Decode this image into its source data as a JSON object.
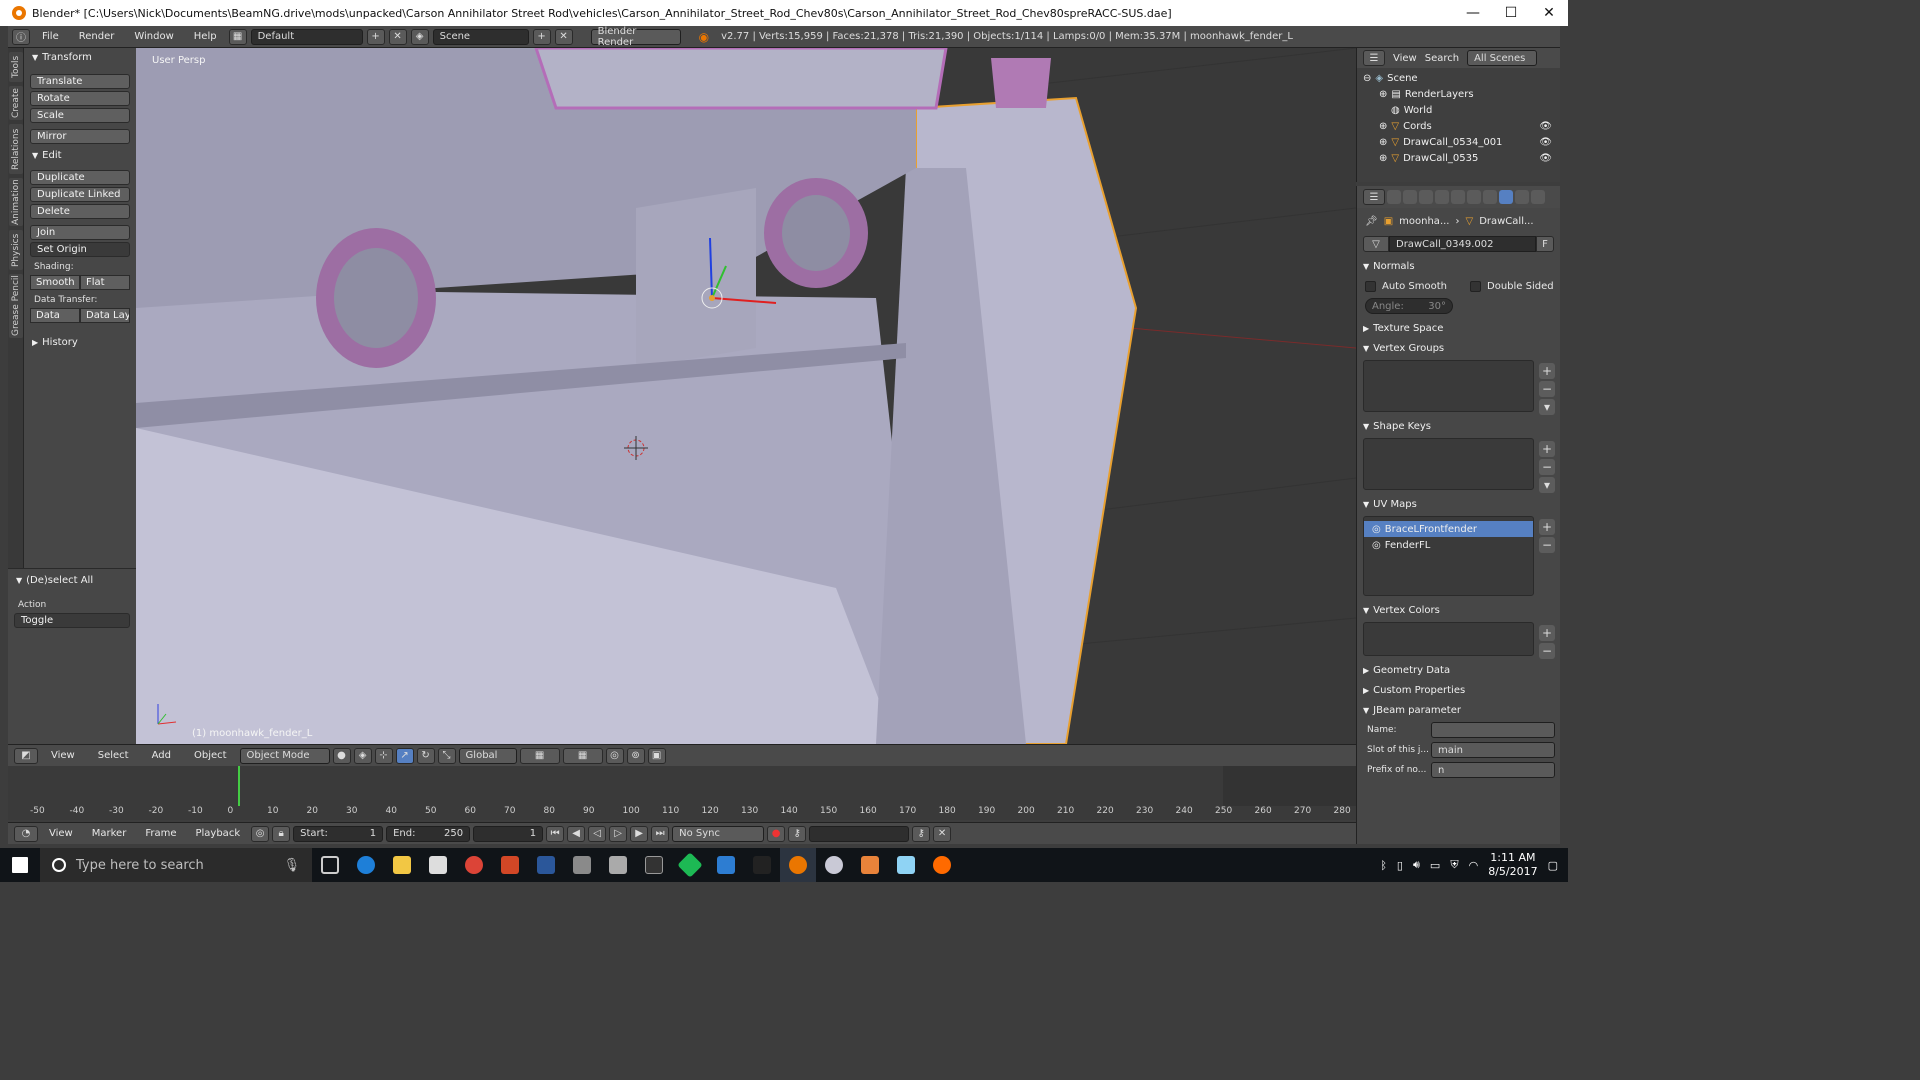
{
  "window": {
    "title": "Blender* [C:\\Users\\Nick\\Documents\\BeamNG.drive\\mods\\unpacked\\Carson Annihilator Street Rod\\vehicles\\Carson_Annihilator_Street_Rod_Chev80s\\Carson_Annihilator_Street_Rod_Chev80spreRACC-SUS.dae]",
    "minimize": "—",
    "maximize": "☐",
    "close": "✕"
  },
  "topbar": {
    "menus": [
      "File",
      "Render",
      "Window",
      "Help"
    ],
    "layout": "Default",
    "scene": "Scene",
    "engine": "Blender Render",
    "stats": "v2.77 | Verts:15,959 | Faces:21,378 | Tris:21,390 | Objects:1/114 | Lamps:0/0 | Mem:35.37M | moonhawk_fender_L"
  },
  "tabs": [
    "Tools",
    "Create",
    "Relations",
    "Animation",
    "Physics",
    "Grease Pencil"
  ],
  "tools": {
    "transform_header": "Transform",
    "translate": "Translate",
    "rotate": "Rotate",
    "scale": "Scale",
    "mirror": "Mirror",
    "edit_header": "Edit",
    "duplicate": "Duplicate",
    "duplicate_linked": "Duplicate Linked",
    "delete": "Delete",
    "join": "Join",
    "set_origin": "Set Origin",
    "shading_label": "Shading:",
    "smooth": "Smooth",
    "flat": "Flat",
    "data_transfer_label": "Data Transfer:",
    "data": "Data",
    "data_layout": "Data Layo",
    "history": "History"
  },
  "redo": {
    "header": "(De)select All",
    "action_label": "Action",
    "action_value": "Toggle"
  },
  "viewport": {
    "view_label": "User Persp",
    "object_name": "(1) moonhawk_fender_L"
  },
  "viewport_header": {
    "menus": [
      "View",
      "Select",
      "Add",
      "Object"
    ],
    "mode": "Object Mode",
    "orientation": "Global"
  },
  "timeline": {
    "ticks": [
      "-50",
      "-40",
      "-30",
      "-20",
      "-10",
      "0",
      "10",
      "20",
      "30",
      "40",
      "50",
      "60",
      "70",
      "80",
      "90",
      "100",
      "110",
      "120",
      "130",
      "140",
      "150",
      "160",
      "170",
      "180",
      "190",
      "200",
      "210",
      "220",
      "230",
      "240",
      "250",
      "260",
      "270",
      "280"
    ],
    "menus": [
      "View",
      "Marker",
      "Frame",
      "Playback"
    ],
    "start_label": "Start:",
    "start_value": "1",
    "end_label": "End:",
    "end_value": "250",
    "current_frame": "1",
    "sync": "No Sync"
  },
  "outliner": {
    "view": "View",
    "search": "Search",
    "filter": "All Scenes",
    "items": [
      "Scene",
      "RenderLayers",
      "World",
      "Cords",
      "DrawCall_0534_001",
      "DrawCall_0535"
    ]
  },
  "properties": {
    "breadcrumb_object": "moonha...",
    "breadcrumb_mesh": "DrawCall...",
    "mesh_name": "DrawCall_0349.002",
    "fake_user": "F",
    "normals": "Normals",
    "auto_smooth": "Auto Smooth",
    "double_sided": "Double Sided",
    "angle_label": "Angle:",
    "angle_value": "30°",
    "texture_space": "Texture Space",
    "vertex_groups": "Vertex Groups",
    "shape_keys": "Shape Keys",
    "uv_maps": "UV Maps",
    "uv_items": [
      "BraceLFrontfender",
      "FenderFL"
    ],
    "vertex_colors": "Vertex Colors",
    "geometry_data": "Geometry Data",
    "custom_properties": "Custom Properties",
    "jbeam": "JBeam parameter",
    "name_label": "Name:",
    "name_value": "",
    "slot_label": "Slot of this j...",
    "slot_value": "main",
    "prefix_label": "Prefix of no...",
    "prefix_value": "n"
  },
  "taskbar": {
    "search_placeholder": "Type here to search",
    "time": "1:11 AM",
    "date": "8/5/2017"
  },
  "colors": {
    "accent": "#5680c2",
    "blender_orange": "#ea7600",
    "selection_outline": "#e8a030"
  }
}
